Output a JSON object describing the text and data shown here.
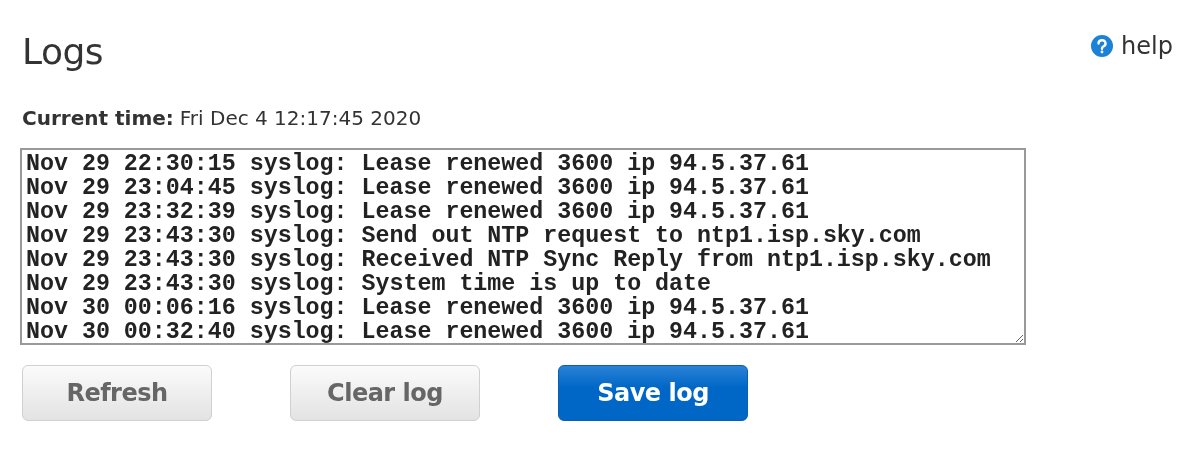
{
  "title": "Logs",
  "help": {
    "label": "help"
  },
  "current_time": {
    "label": "Current time:",
    "value": "Fri Dec 4 12:17:45 2020"
  },
  "log": {
    "lines": [
      "Nov 29 22:30:15 syslog: Lease renewed 3600 ip 94.5.37.61",
      "Nov 29 23:04:45 syslog: Lease renewed 3600 ip 94.5.37.61",
      "Nov 29 23:32:39 syslog: Lease renewed 3600 ip 94.5.37.61",
      "Nov 29 23:43:30 syslog: Send out NTP request to ntp1.isp.sky.com",
      "Nov 29 23:43:30 syslog: Received NTP Sync Reply from ntp1.isp.sky.com",
      "Nov 29 23:43:30 syslog: System time is up to date",
      "Nov 30 00:06:16 syslog: Lease renewed 3600 ip 94.5.37.61",
      "Nov 30 00:32:40 syslog: Lease renewed 3600 ip 94.5.37.61"
    ]
  },
  "buttons": [
    {
      "label": "Refresh",
      "kind": "secondary"
    },
    {
      "label": "Clear log",
      "kind": "secondary"
    },
    {
      "label": "Save log",
      "kind": "primary"
    }
  ]
}
